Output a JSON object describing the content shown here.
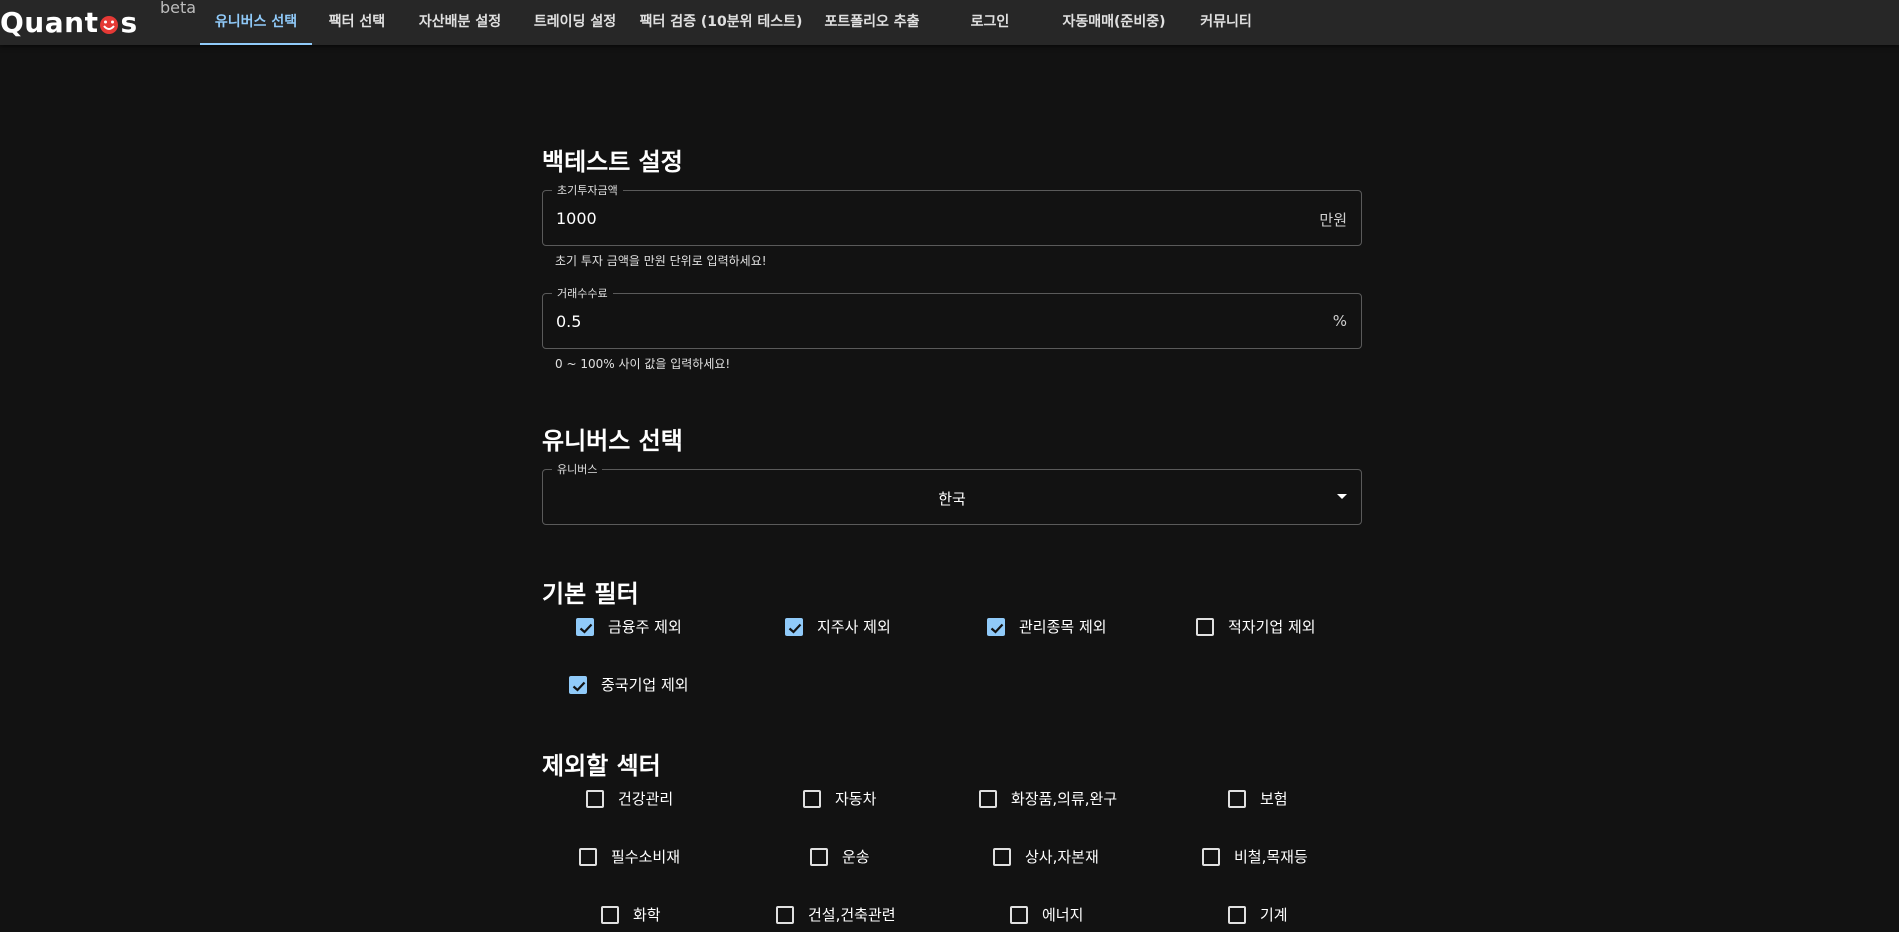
{
  "nav": {
    "logo": "Quantus",
    "logo_left": "Quant",
    "logo_right": "s",
    "beta": "beta",
    "tabs": [
      {
        "label": "유니버스 선택"
      },
      {
        "label": "팩터 선택"
      },
      {
        "label": "자산배분 설정"
      },
      {
        "label": "트레이딩 설정"
      },
      {
        "label": "팩터 검증 (10분위 테스트)"
      },
      {
        "label": "포트폴리오 추출"
      },
      {
        "label": "로그인"
      },
      {
        "label": "자동매매(준비중)"
      },
      {
        "label": "커뮤니티"
      }
    ],
    "active_tab": 0,
    "accent": "#90caf9"
  },
  "backtest": {
    "title": "백테스트 설정",
    "initial_investment": {
      "label": "초기투자금액",
      "value": "1000",
      "unit": "만원",
      "helper": "초기 투자 금액을 만원 단위로 입력하세요!"
    },
    "fee": {
      "label": "거래수수료",
      "value": "0.5",
      "unit": "%",
      "helper": "0 ~ 100% 사이 값을 입력하세요!"
    }
  },
  "universe": {
    "title": "유니버스 선택",
    "label": "유니버스",
    "value": "한국"
  },
  "basic_filter": {
    "title": "기본 필터",
    "items": [
      {
        "label": "금융주 제외",
        "checked": true
      },
      {
        "label": "지주사 제외",
        "checked": true
      },
      {
        "label": "관리종목 제외",
        "checked": true
      },
      {
        "label": "적자기업 제외",
        "checked": false
      },
      {
        "label": "중국기업 제외",
        "checked": true
      }
    ]
  },
  "sector_exclude": {
    "title": "제외할 섹터",
    "items": [
      {
        "label": "건강관리",
        "checked": false
      },
      {
        "label": "자동차",
        "checked": false
      },
      {
        "label": "화장품,의류,완구",
        "checked": false
      },
      {
        "label": "보험",
        "checked": false
      },
      {
        "label": "필수소비재",
        "checked": false
      },
      {
        "label": "운송",
        "checked": false
      },
      {
        "label": "상사,자본재",
        "checked": false
      },
      {
        "label": "비철,목재등",
        "checked": false
      },
      {
        "label": "화학",
        "checked": false
      },
      {
        "label": "건설,건축관련",
        "checked": false
      },
      {
        "label": "에너지",
        "checked": false
      },
      {
        "label": "기계",
        "checked": false
      }
    ]
  }
}
